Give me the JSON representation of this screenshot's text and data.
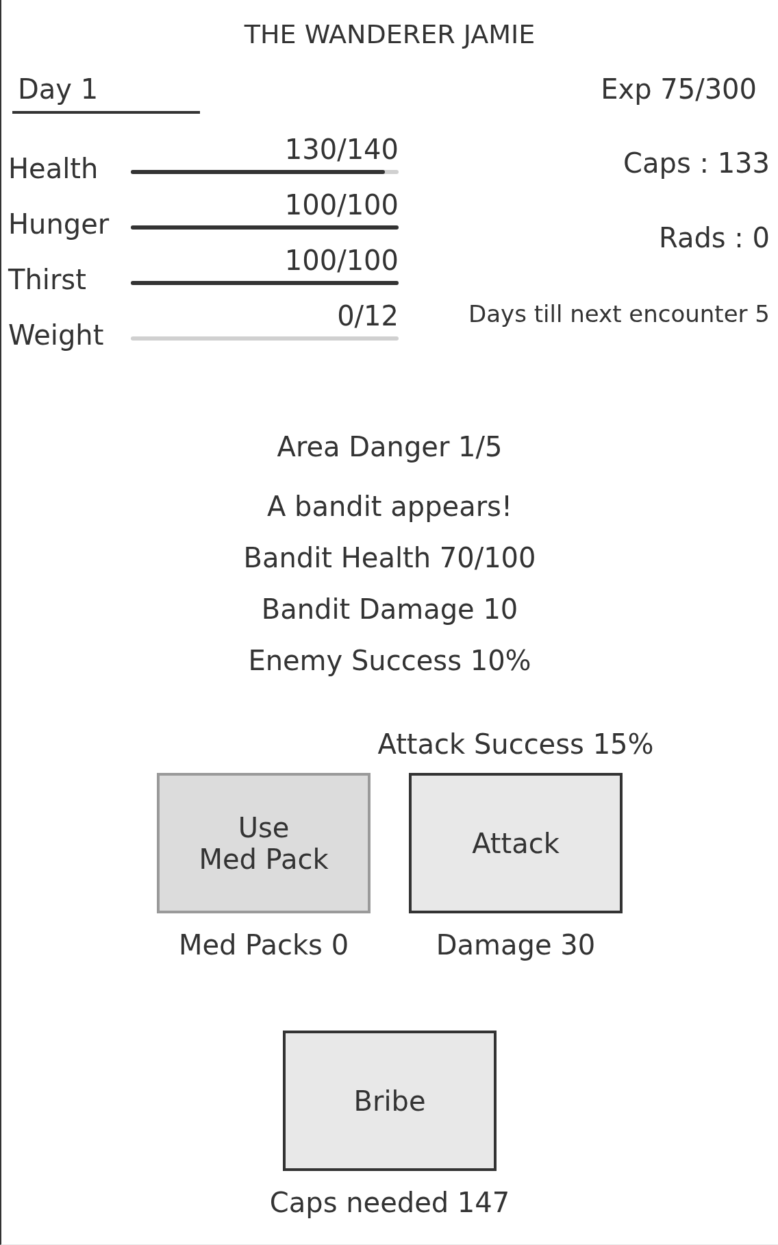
{
  "title": "THE WANDERER JAMIE",
  "day": "Day 1",
  "exp": "Exp 75/300",
  "stats": [
    {
      "label": "Health",
      "reading": "130/140",
      "level": 0.95
    },
    {
      "label": "Hunger",
      "reading": "100/100",
      "level": 1
    },
    {
      "label": "Thirst",
      "reading": "100/100",
      "level": 1
    },
    {
      "label": "Weight",
      "reading": "0/12"
    }
  ],
  "caps": "Caps : 133",
  "rads": "Rads : 0",
  "next_encounter": "Days till next encounter 5",
  "area_danger": "Area Danger 1/5",
  "encounter": [
    "A bandit appears!",
    "Bandit Health 70/100",
    "Bandit Damage 10",
    "Enemy Success 10%"
  ],
  "action_rows": [
    {
      "actions": [
        {
          "label": "Use\nMed Pack",
          "note": "Med Packs 0",
          "disabled": true
        },
        {
          "caption": "Attack Success 15%",
          "label": "Attack",
          "note": "Damage 30",
          "disabled": false
        }
      ]
    },
    {
      "actions": [
        {
          "label": "Bribe",
          "note": "Caps needed 147",
          "disabled": false
        }
      ]
    }
  ]
}
